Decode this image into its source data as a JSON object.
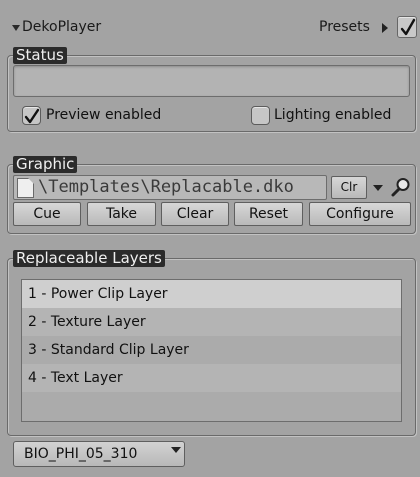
{
  "header": {
    "title": "DekoPlayer",
    "presets_label": "Presets",
    "presets_checked": true,
    "collapse_icon": "triangle-down-icon",
    "presets_icon": "triangle-right-icon"
  },
  "status": {
    "group_label": "Status",
    "status_text": "",
    "preview_label": "Preview enabled",
    "preview_checked": true,
    "lighting_label": "Lighting enabled",
    "lighting_checked": false
  },
  "graphic": {
    "group_label": "Graphic",
    "path": "\\Templates\\Replacable.dko",
    "file_icon": "document-icon",
    "clr_label": "Clr",
    "search_icon": "magnifier-icon",
    "buttons": {
      "cue": "Cue",
      "take": "Take",
      "clear": "Clear",
      "reset": "Reset",
      "configure": "Configure"
    }
  },
  "layers": {
    "group_label": "Replaceable Layers",
    "items": [
      "1 - Power Clip Layer",
      "2 - Texture Layer",
      "3 - Standard Clip Layer",
      "4 - Text Layer"
    ],
    "selected_index": 0
  },
  "channel": {
    "value": "BIO_PHI_05_310"
  },
  "colors": {
    "background": "#a3a3a3",
    "group_label_bg": "#2b2b2b",
    "group_label_text": "#f0f0f0",
    "selected_row": "#cfcfcf"
  }
}
